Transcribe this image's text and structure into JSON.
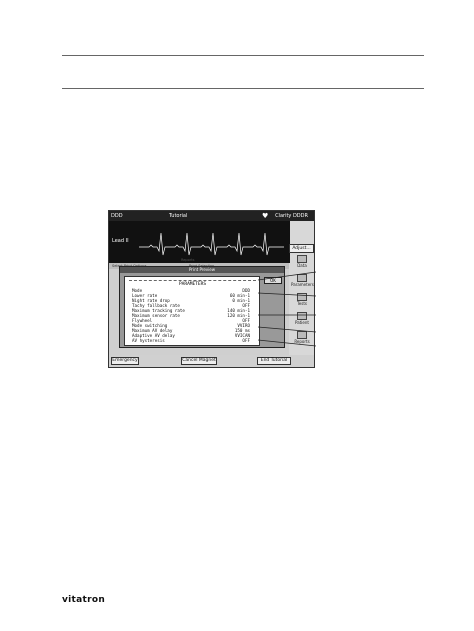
{
  "footer": {
    "brand": "vitatron"
  },
  "app": {
    "titlebar": {
      "left": "DDD",
      "center": "Tutorial",
      "right": "Clarity DDDR"
    },
    "ecg": {
      "label": "Lead II"
    },
    "side_buttons": {
      "adjust": "Adjust...",
      "data": "Data",
      "params": "Parameters",
      "tests": "Tests",
      "patient": "Patient",
      "reports": "Reports"
    },
    "tabs": {
      "mid": "Reports",
      "a": "Select Print Options",
      "b": "Print Selection"
    },
    "preview": {
      "title": "Print Preview",
      "ok": "OK",
      "params_title": "PARAMETERS",
      "rows": [
        {
          "name": "Mode",
          "value": "DDD"
        },
        {
          "name": "Lower rate",
          "value": "60 min-1"
        },
        {
          "name": "Night rate drop",
          "value": "0 min-1"
        },
        {
          "name": "Tachy fallback rate",
          "value": "OFF"
        },
        {
          "name": "Maximum tracking rate",
          "value": "140 min-1"
        },
        {
          "name": "Maximum sensor rate",
          "value": "120 min-1"
        },
        {
          "name": "Flywheel",
          "value": "OFF"
        },
        {
          "name": "Mode switching",
          "value": "VVIRO"
        },
        {
          "name": "Maximum AV delay",
          "value": "150 ms"
        },
        {
          "name": "Adaptive AV delay",
          "value": "VVICAN"
        },
        {
          "name": "AV hysteresis",
          "value": "OFF"
        }
      ]
    },
    "bottom_buttons": {
      "emergency": "Emergency",
      "cancel_magnet": "Cancel Magnet",
      "end_tutorial": "End Tutorial"
    }
  }
}
